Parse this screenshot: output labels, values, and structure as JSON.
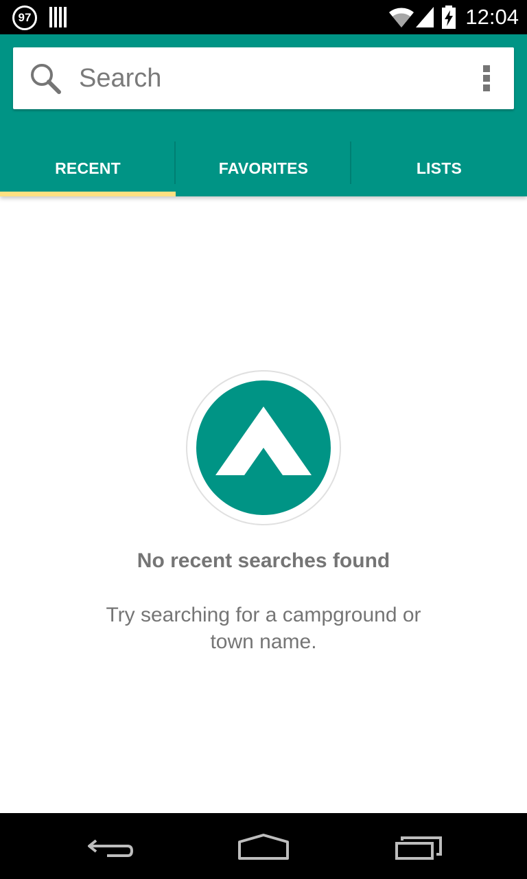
{
  "status_bar": {
    "notification_badge": "97",
    "time": "12:04"
  },
  "search": {
    "placeholder": "Search",
    "value": ""
  },
  "tabs": [
    {
      "label": "RECENT",
      "selected": true
    },
    {
      "label": "FAVORITES",
      "selected": false
    },
    {
      "label": "LISTS",
      "selected": false
    }
  ],
  "empty_state": {
    "title": "No recent searches found",
    "message": "Try searching for a campground or town name."
  },
  "icons": {
    "search": "search-icon",
    "overflow": "more-vert-icon",
    "logo": "tent-logo-icon",
    "back": "back-icon",
    "home": "home-icon",
    "recents": "recent-apps-icon"
  },
  "colors": {
    "primary": "#009485",
    "tab_indicator": "#ffe082",
    "empty_text": "#757575"
  }
}
